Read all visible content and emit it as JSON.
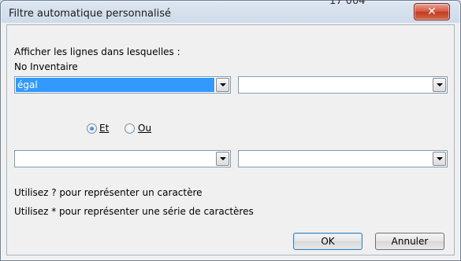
{
  "background": {
    "visible_number": "17 004"
  },
  "dialog": {
    "title": "Filtre automatique personnalisé",
    "close_glyph": "✕",
    "instruction": "Afficher les lignes dans lesquelles :",
    "field_name": "No Inventaire",
    "condition1": {
      "operator": "égal",
      "value": ""
    },
    "logic": {
      "and_label": "Et",
      "or_label": "Ou",
      "selected": "Et"
    },
    "condition2": {
      "operator": "",
      "value": ""
    },
    "hint1": "Utilisez ? pour représenter un caractère",
    "hint2": "Utilisez * pour représenter une série de caractères",
    "ok_label": "OK",
    "cancel_label": "Annuler"
  },
  "colors": {
    "selection": "#3399ff",
    "close_button": "#c23a1f"
  }
}
